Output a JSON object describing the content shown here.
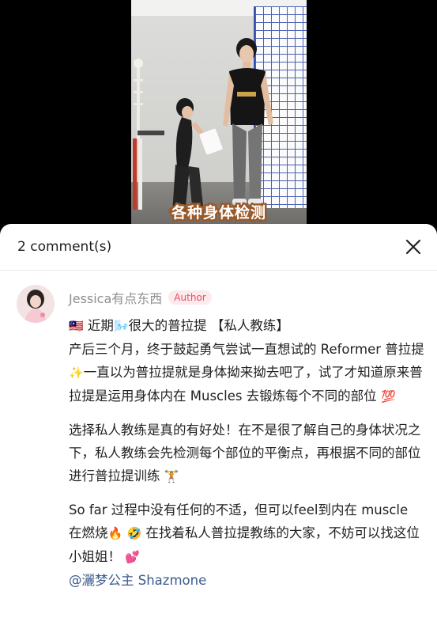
{
  "video": {
    "caption": "各种身体检测"
  },
  "comments_panel": {
    "count_label": "2 comment(s)",
    "close_icon": "close-icon"
  },
  "comment": {
    "author": "Jessica有点东西",
    "badge": "Author",
    "line1_emoji_flag": "🇲🇾",
    "line1_a": " 近期",
    "line1_emoji_wind": "🌬️",
    "line1_b": "很大的普拉提 【私人教练】",
    "p1_a": "产后三个月，终于鼓起勇气尝试一直想试的 Reformer 普拉提",
    "p1_emoji_sparkles": "✨",
    "p1_b": "一直以为普拉提就是身体拗来拗去吧了，试了才知道原来普拉提是运用身体内在 Muscles 去锻炼每个不同的部位",
    "p1_emoji_100": "💯",
    "p2_a": "选择私人教练是真的有好处！在不是很了解自己的身体状况之下，私人教练会先检测每个部位的平衡点，再根据不同的部位进行普拉提训练",
    "p2_emoji": "🏋️",
    "p3_a": "So far 过程中没有任何的不适，但可以feel到内在 muscle 在燃烧",
    "p3_emoji_fire": "🔥",
    "p3_emoji_laugh": "🤣",
    "p3_b": " 在找着私人普拉提教练的大家，不妨可以找这位小姐姐！",
    "p3_emoji_hearts": "💕",
    "mention": "@灑梦公主 Shazmone"
  },
  "colors": {
    "author_badge_text": "#ee4c5f",
    "author_badge_bg": "#fdeaec",
    "mention": "#3c5b8c"
  }
}
